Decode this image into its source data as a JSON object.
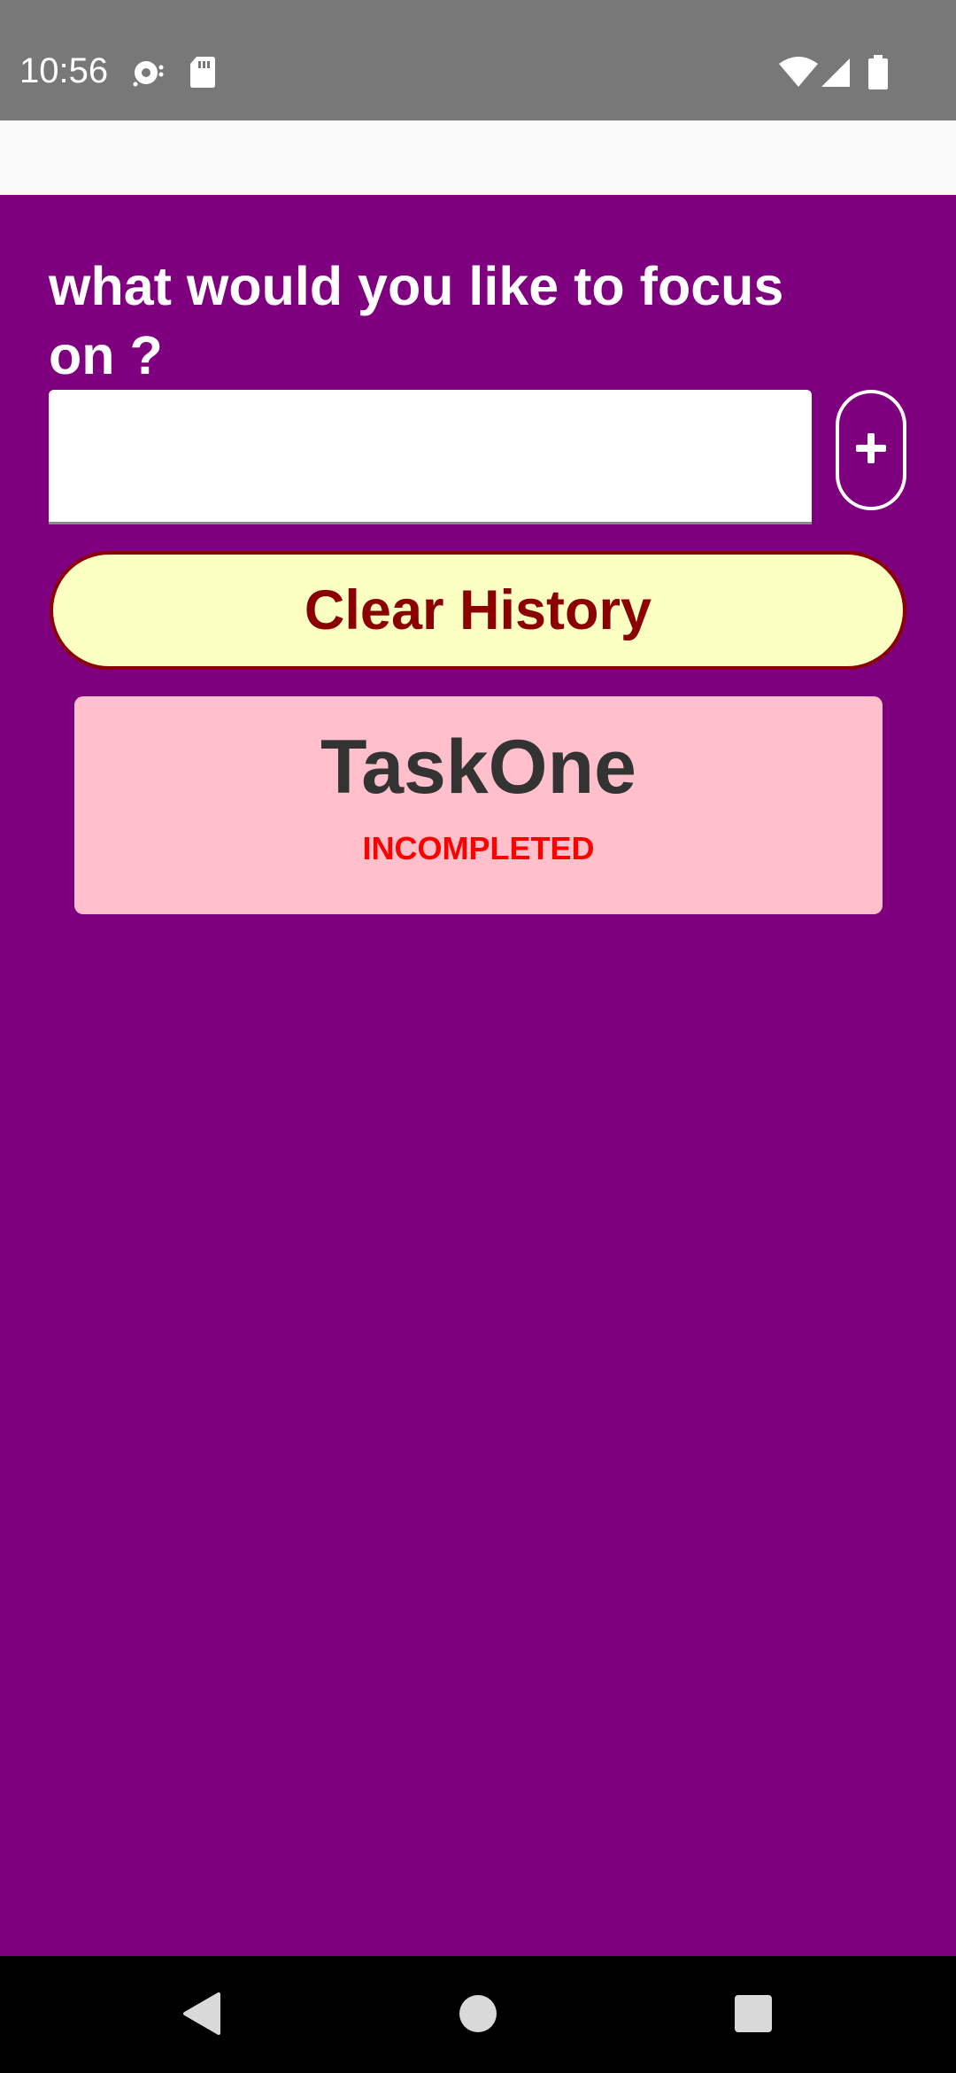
{
  "status_bar": {
    "time": "10:56",
    "icons": [
      "sync-icon",
      "sd-card-icon",
      "wifi-icon",
      "cell-signal-icon",
      "battery-icon"
    ]
  },
  "main": {
    "prompt": "what would you like to focus on ?",
    "input": {
      "value": "",
      "placeholder": ""
    },
    "add_button_icon": "plus-icon",
    "clear_button_label": "Clear History",
    "tasks": [
      {
        "title": "TaskOne",
        "status": "INCOMPLETED"
      }
    ]
  },
  "nav_bar": {
    "icons": [
      "back-icon",
      "home-icon",
      "recents-icon"
    ]
  },
  "colors": {
    "background": "#7e007e",
    "status_bar": "#787878",
    "app_bar": "#fafafa",
    "clear_button_bg": "#fcffc2",
    "clear_button_text": "#8b0000",
    "task_card_bg": "#ffc0cb",
    "task_title": "#333333",
    "task_status": "#ff0000"
  }
}
